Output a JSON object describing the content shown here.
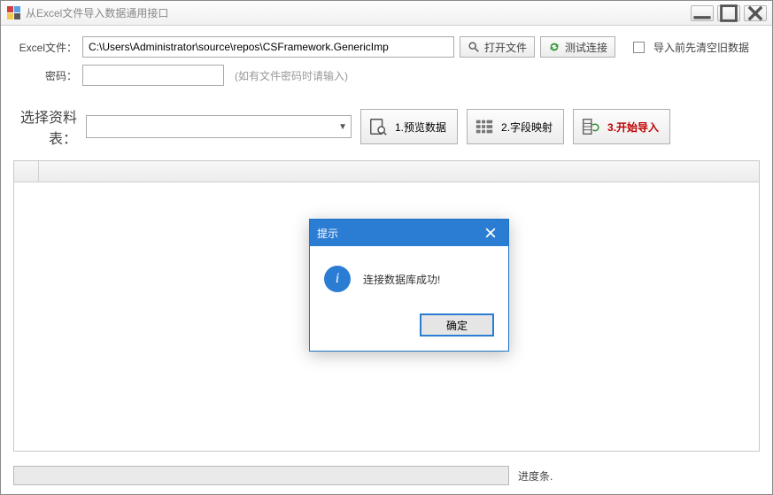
{
  "window": {
    "title": "从Excel文件导入数据通用接口"
  },
  "row1": {
    "label": "Excel文件：",
    "path": "C:\\Users\\Administrator\\source\\repos\\CSFramework.GenericImp",
    "open_btn": "打开文件",
    "test_btn": "测试连接",
    "checkbox_label": "导入前先清空旧数据"
  },
  "row2": {
    "label": "密码：",
    "hint": "(如有文件密码时请输入)"
  },
  "steps": {
    "label": "选择资料表：",
    "s1": "1.预览数据",
    "s2": "2.字段映射",
    "s3": "3.开始导入"
  },
  "progress": {
    "label": "进度条."
  },
  "modal": {
    "title": "提示",
    "message": "连接数据库成功!",
    "ok": "确定"
  }
}
